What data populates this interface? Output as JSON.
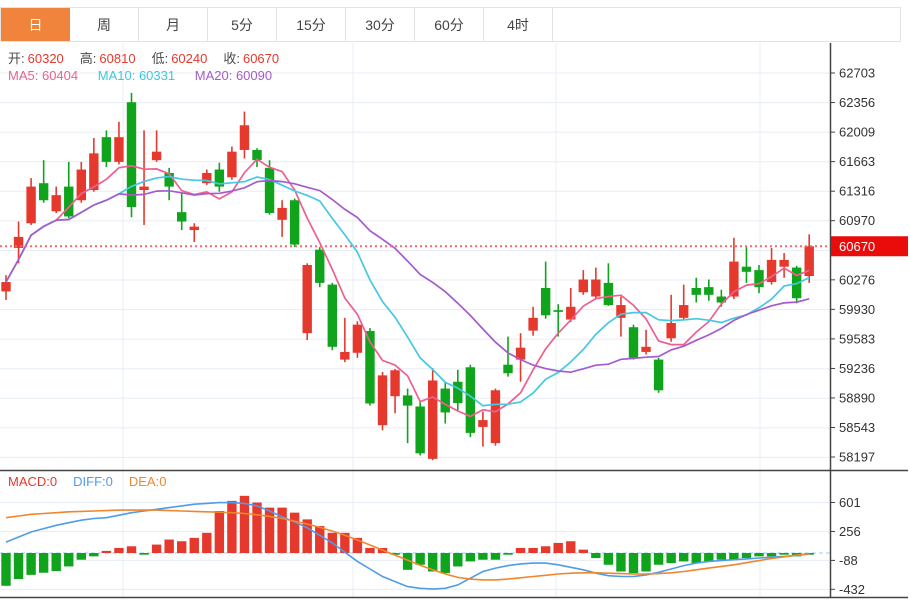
{
  "tabs": {
    "items": [
      {
        "label": "日",
        "active": true
      },
      {
        "label": "周",
        "active": false
      },
      {
        "label": "月",
        "active": false
      },
      {
        "label": "5分",
        "active": false
      },
      {
        "label": "15分",
        "active": false
      },
      {
        "label": "30分",
        "active": false
      },
      {
        "label": "60分",
        "active": false
      },
      {
        "label": "4时",
        "active": false
      }
    ]
  },
  "main_legend": {
    "open_label": "开:",
    "open": "60320",
    "high_label": "高:",
    "high": "60810",
    "low_label": "低:",
    "low": "60240",
    "close_label": "收:",
    "close": "60670"
  },
  "ma_legend": {
    "ma5_label": "MA5:",
    "ma5": "60404",
    "ma10_label": "MA10:",
    "ma10": "60331",
    "ma20_label": "MA20:",
    "ma20": "60090"
  },
  "macd_legend": {
    "macd_label": "MACD:",
    "macd": "0",
    "diff_label": "DIFF:",
    "diff": "0",
    "dea_label": "DEA:",
    "dea": "0"
  },
  "price_axis": {
    "ticks": [
      62703,
      62356,
      62009,
      61663,
      61316,
      60970,
      60276,
      59930,
      59583,
      59236,
      58890,
      58543,
      58197
    ],
    "current": 60670
  },
  "macd_axis": {
    "ticks": [
      601,
      256,
      -88,
      -432
    ]
  },
  "colors": {
    "accent_orange": "#f0843c",
    "up": "#e6392d",
    "down": "#0fa41b",
    "ma5": "#ee5f92",
    "ma10": "#45c8e2",
    "ma20": "#a55bcc",
    "diff": "#4f9ce8",
    "dea": "#f0862d",
    "dotted": "#f56a6a",
    "price_label_bg": "#ea0b0b",
    "grid": "#e7edf5",
    "zero_dash": "#8ed4ea",
    "axis_line": "#444",
    "tick_text": "#333"
  },
  "chart_data": {
    "type": "candlestick",
    "title": "",
    "interval": "日",
    "price_axis_range": [
      58044,
      63070
    ],
    "macd_axis_range": [
      -530,
      840
    ],
    "legend_position": "top-left",
    "grid": true,
    "candles": [
      [
        60140,
        60330,
        60040,
        60250
      ],
      [
        60650,
        60960,
        60470,
        60780
      ],
      [
        60940,
        61470,
        60920,
        61370
      ],
      [
        61410,
        61680,
        61180,
        61210
      ],
      [
        61080,
        61370,
        61060,
        61270
      ],
      [
        61370,
        61660,
        61000,
        61020
      ],
      [
        61210,
        61660,
        61180,
        61570
      ],
      [
        61330,
        61940,
        61310,
        61760
      ],
      [
        61950,
        62030,
        61600,
        61660
      ],
      [
        61660,
        62130,
        61630,
        61950
      ],
      [
        62360,
        62470,
        61010,
        61130
      ],
      [
        61330,
        62030,
        60920,
        61370
      ],
      [
        61680,
        62030,
        61660,
        61780
      ],
      [
        61530,
        61590,
        61210,
        61370
      ],
      [
        61070,
        61300,
        60860,
        60960
      ],
      [
        60860,
        60940,
        60720,
        60900
      ],
      [
        61410,
        61570,
        61390,
        61530
      ],
      [
        61570,
        61650,
        61310,
        61370
      ],
      [
        61480,
        61840,
        61450,
        61780
      ],
      [
        61800,
        62250,
        61700,
        62090
      ],
      [
        61800,
        61820,
        61600,
        61680
      ],
      [
        61590,
        61680,
        61040,
        61060
      ],
      [
        60980,
        61210,
        60780,
        61120
      ],
      [
        61210,
        61230,
        60660,
        60690
      ],
      [
        59650,
        60470,
        59570,
        60450
      ],
      [
        60630,
        60660,
        60190,
        60240
      ],
      [
        60220,
        60240,
        59450,
        59490
      ],
      [
        59340,
        59830,
        59310,
        59430
      ],
      [
        59420,
        59790,
        59360,
        59750
      ],
      [
        59675,
        59710,
        58800,
        58825
      ],
      [
        58570,
        59195,
        58510,
        59155
      ],
      [
        58910,
        59230,
        58710,
        59215
      ],
      [
        58920,
        59000,
        58360,
        58800
      ],
      [
        58790,
        58850,
        58215,
        58240
      ],
      [
        58175,
        59240,
        58160,
        59095
      ],
      [
        59000,
        59080,
        58590,
        58720
      ],
      [
        59080,
        59220,
        58730,
        58830
      ],
      [
        59250,
        59280,
        58430,
        58480
      ],
      [
        58550,
        58730,
        58320,
        58630
      ],
      [
        58360,
        59000,
        58330,
        58980
      ],
      [
        59280,
        59610,
        59140,
        59180
      ],
      [
        59340,
        59650,
        59080,
        59480
      ],
      [
        59680,
        59960,
        59620,
        59830
      ],
      [
        60180,
        60490,
        59820,
        59860
      ],
      [
        59920,
        59990,
        59610,
        59900
      ],
      [
        59810,
        60180,
        59780,
        59960
      ],
      [
        60130,
        60390,
        60100,
        60280
      ],
      [
        60080,
        60420,
        60050,
        60280
      ],
      [
        60240,
        60470,
        59970,
        59980
      ],
      [
        59830,
        60080,
        59610,
        59980
      ],
      [
        59720,
        59750,
        59340,
        59360
      ],
      [
        59430,
        59690,
        59400,
        59490
      ],
      [
        59340,
        59360,
        58950,
        58980
      ],
      [
        59590,
        60100,
        59550,
        59770
      ],
      [
        59830,
        60220,
        59810,
        59980
      ],
      [
        60180,
        60300,
        60010,
        60100
      ],
      [
        60190,
        60280,
        60030,
        60100
      ],
      [
        60080,
        60160,
        59960,
        60010
      ],
      [
        60080,
        60770,
        60050,
        60490
      ],
      [
        60430,
        60660,
        60240,
        60370
      ],
      [
        60390,
        60450,
        60120,
        60190
      ],
      [
        60250,
        60650,
        60220,
        60510
      ],
      [
        60430,
        60590,
        60300,
        60510
      ],
      [
        60420,
        60440,
        60000,
        60060
      ],
      [
        60320,
        60810,
        60240,
        60670
      ]
    ],
    "moving_average_periods": [
      5,
      10,
      20
    ],
    "macd": {
      "histogram": [
        -390,
        -310,
        -260,
        -235,
        -215,
        -160,
        -80,
        -40,
        25,
        60,
        80,
        -20,
        100,
        160,
        140,
        180,
        240,
        500,
        620,
        680,
        600,
        540,
        540,
        480,
        400,
        320,
        240,
        240,
        180,
        60,
        60,
        -20,
        -200,
        -140,
        -220,
        -240,
        -160,
        -100,
        -80,
        -80,
        -20,
        60,
        60,
        80,
        120,
        140,
        40,
        -60,
        -140,
        -220,
        -240,
        -220,
        -140,
        -120,
        -100,
        -120,
        -100,
        -80,
        -80,
        -60,
        -40,
        -40,
        -20,
        -40,
        -20
      ],
      "diff": [
        130,
        190,
        250,
        290,
        330,
        360,
        390,
        410,
        420,
        450,
        480,
        500,
        520,
        540,
        560,
        580,
        590,
        600,
        600,
        590,
        560,
        500,
        430,
        370,
        300,
        210,
        120,
        10,
        -100,
        -190,
        -280,
        -340,
        -400,
        -420,
        -430,
        -420,
        -380,
        -300,
        -220,
        -180,
        -150,
        -130,
        -120,
        -120,
        -140,
        -170,
        -200,
        -240,
        -270,
        -280,
        -280,
        -260,
        -230,
        -190,
        -150,
        -120,
        -100,
        -90,
        -80,
        -70,
        -60,
        -50,
        -40,
        -30,
        -10
      ],
      "dea": [
        420,
        440,
        460,
        470,
        480,
        490,
        495,
        500,
        505,
        510,
        510,
        510,
        510,
        505,
        500,
        495,
        490,
        485,
        480,
        470,
        455,
        435,
        410,
        380,
        345,
        305,
        260,
        210,
        155,
        95,
        35,
        -25,
        -85,
        -145,
        -200,
        -250,
        -290,
        -310,
        -320,
        -320,
        -310,
        -295,
        -280,
        -265,
        -250,
        -240,
        -235,
        -235,
        -240,
        -245,
        -250,
        -250,
        -245,
        -235,
        -220,
        -200,
        -180,
        -160,
        -140,
        -115,
        -90,
        -65,
        -45,
        -25,
        -10
      ]
    }
  }
}
